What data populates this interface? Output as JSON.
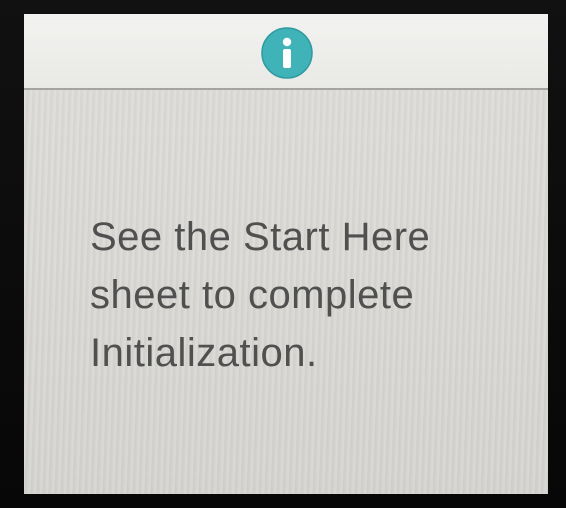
{
  "header": {
    "icon": "info-icon",
    "icon_color": "#3fb3b8"
  },
  "message": {
    "lines": [
      "See the Start Here",
      "sheet to complete",
      "Initialization."
    ]
  },
  "colors": {
    "header_bg": "#efefed",
    "screen_bg": "#d8d7d3",
    "text": "#505050"
  }
}
